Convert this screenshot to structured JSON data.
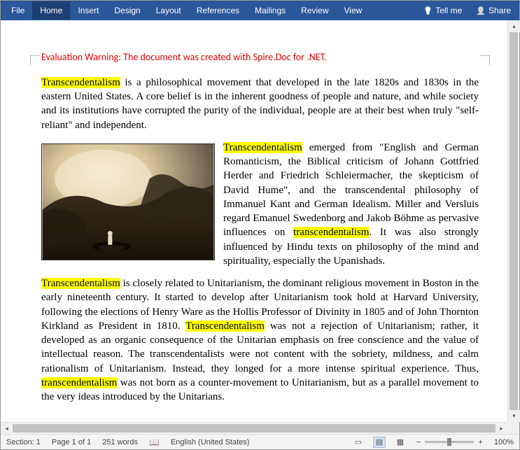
{
  "ribbon": {
    "tabs": [
      "File",
      "Home",
      "Insert",
      "Design",
      "Layout",
      "References",
      "Mailings",
      "Review",
      "View"
    ],
    "tellme": "Tell me",
    "share": "Share"
  },
  "warning": "Evaluation Warning: The document was created with Spire.Doc for .NET.",
  "p1": {
    "hl": "Transcendentalism",
    "rest": " is a philosophical movement that developed in the late 1820s and 1830s in the eastern United States. A core belief is in the inherent goodness of people and nature, and while society and its institutions have corrupted the purity of the individual, people are at their best when truly \"self-reliant\" and independent."
  },
  "p2": {
    "lead": " ",
    "hl1": "Transcendentalism",
    "mid1": " emerged from \"English and German Romanticism, the Biblical criticism of Johann Gottfried Herder and Friedrich Schleiermacher, the skepticism of David Hume\", and the transcendental philosophy of Immanuel Kant and German Idealism. Miller and Versluis regard Emanuel Swedenborg and Jakob Böhme as pervasive influences on ",
    "hl2": "transcendentalism",
    "end": ". It was also strongly influenced by Hindu texts on philosophy of the mind and spirituality, especially the Upanishads."
  },
  "p3": {
    "hl1": "Transcendentalism",
    "mid1": " is closely related to Unitarianism, the dominant religious movement in Boston in the early nineteenth century. It started to develop after Unitarianism took hold at Harvard University, following the elections of Henry Ware as the Hollis Professor of Divinity in 1805 and of John Thornton Kirkland as President in 1810. ",
    "hl2": "Transcendentalism",
    "mid2": " was not a rejection of Unitarianism; rather, it developed as an organic consequence of the Unitarian emphasis on free conscience and the value of intellectual reason. The transcendentalists were not content with the sobriety, mildness, and calm rationalism of Unitarianism. Instead, they longed for a more intense spiritual experience. Thus, ",
    "hl3": "transcendentalism",
    "end": " was not born as a counter-movement to Unitarianism, but as a parallel movement to the very ideas introduced by the Unitarians."
  },
  "status": {
    "section": "Section: 1",
    "page": "Page 1 of 1",
    "words": "251 words",
    "lang": "English (United States)",
    "zoom": "100%"
  }
}
